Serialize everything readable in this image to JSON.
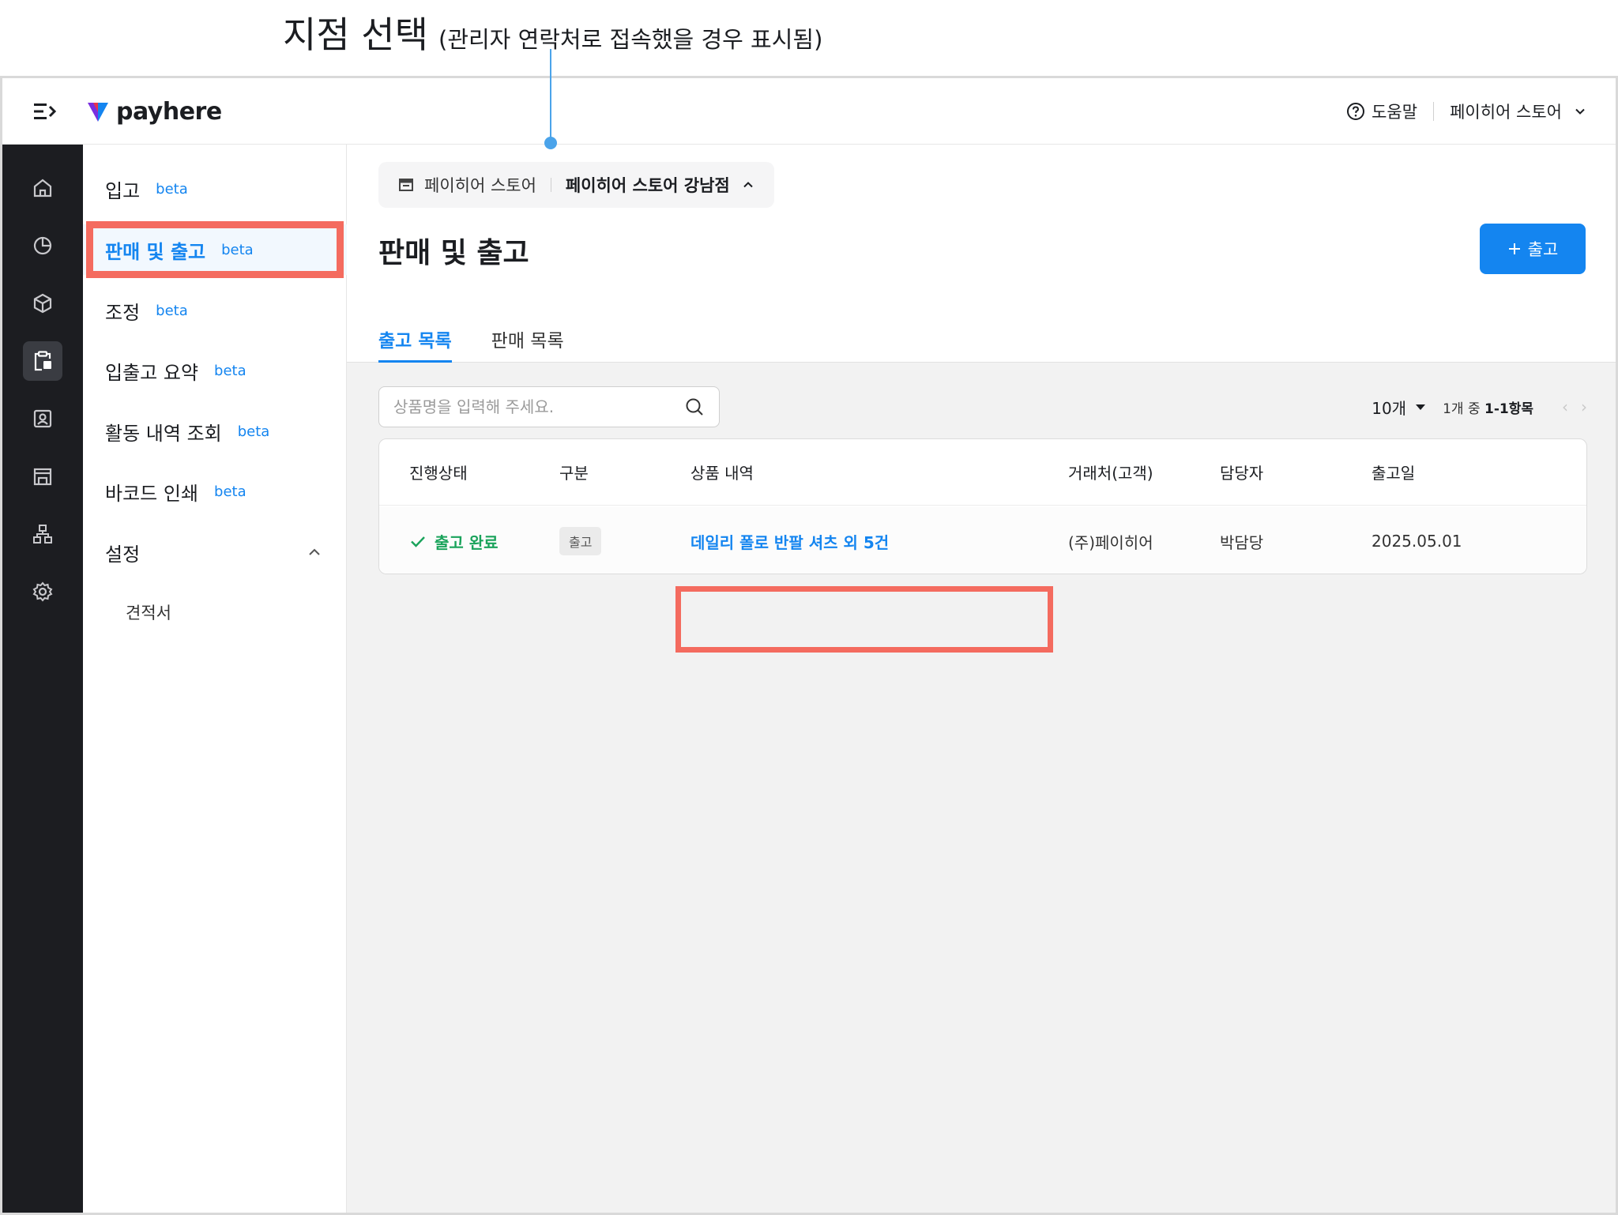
{
  "annotation": {
    "title": "지점 선택",
    "subtitle": "(관리자 연락처로 접속했을 경우 표시됨)"
  },
  "colors": {
    "accent": "#1485f0",
    "highlight": "#f46b5f",
    "success": "#1aa35b",
    "rail": "#1c1d21"
  },
  "topbar": {
    "logo_text": "payhere",
    "help_label": "도움말",
    "store_name": "페이히어 스토어"
  },
  "rail": {
    "icons": [
      "home-icon",
      "chart-icon",
      "box-icon",
      "clipboard-icon",
      "contact-icon",
      "store-icon",
      "org-icon",
      "gear-icon"
    ]
  },
  "submenu": {
    "beta_label": "beta",
    "items": [
      {
        "label": "입고",
        "beta": "beta"
      },
      {
        "label": "판매 및 출고",
        "beta": "beta"
      },
      {
        "label": "조정",
        "beta": "beta"
      },
      {
        "label": "입출고 요약",
        "beta": "beta"
      },
      {
        "label": "활동 내역 조회",
        "beta": "beta"
      },
      {
        "label": "바코드 인쇄",
        "beta": "beta"
      }
    ],
    "settings_label": "설정",
    "settings_children": [
      "견적서"
    ]
  },
  "main": {
    "branch": {
      "store": "페이히어 스토어",
      "branch": "페이히어 스토어 강남점"
    },
    "page_title": "판매 및 출고",
    "add_button": "출고",
    "tabs": [
      "출고 목록",
      "판매 목록"
    ],
    "search_placeholder": "상품명을 입력해 주세요.",
    "page_size": "10개",
    "range_prefix": "1개 중",
    "range_value": "1-1항목"
  },
  "table": {
    "headers": [
      "진행상태",
      "구분",
      "상품 내역",
      "거래처(고객)",
      "담당자",
      "출고일"
    ],
    "rows": [
      {
        "status": "출고 완료",
        "type": "출고",
        "product": "데일리 폴로 반팔 셔츠 외 5건",
        "customer": "(주)페이히어",
        "manager": "박담당",
        "date": "2025.05.01"
      }
    ]
  }
}
